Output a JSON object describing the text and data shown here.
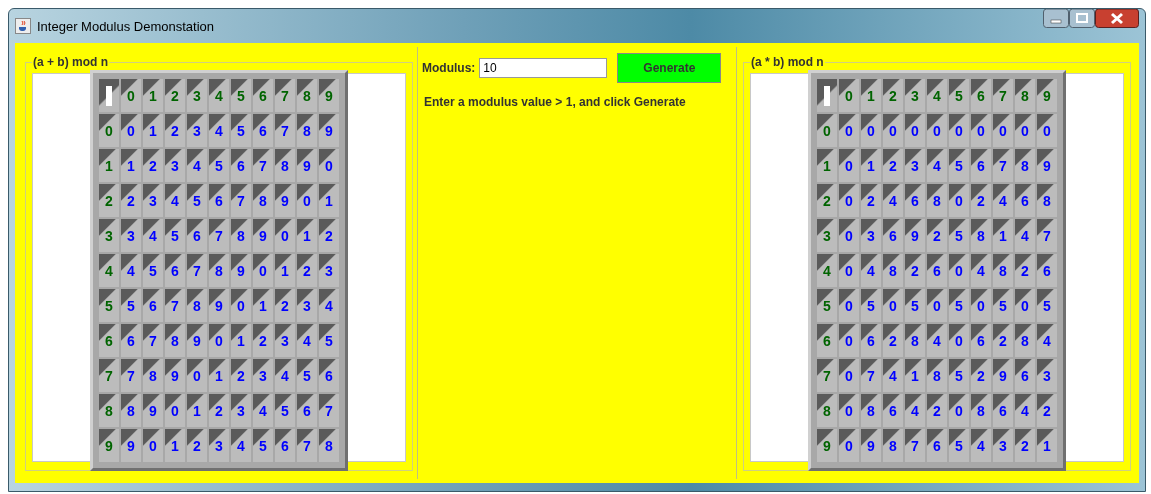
{
  "window": {
    "title": "Integer Modulus Demonstation"
  },
  "addition_panel": {
    "title": "(a + b) mod n",
    "column_headers": [
      "0",
      "1",
      "2",
      "3",
      "4",
      "5",
      "6",
      "7",
      "8",
      "9"
    ],
    "rows": [
      {
        "header": "0",
        "cells": [
          "0",
          "1",
          "2",
          "3",
          "4",
          "5",
          "6",
          "7",
          "8",
          "9"
        ]
      },
      {
        "header": "1",
        "cells": [
          "1",
          "2",
          "3",
          "4",
          "5",
          "6",
          "7",
          "8",
          "9",
          "0"
        ]
      },
      {
        "header": "2",
        "cells": [
          "2",
          "3",
          "4",
          "5",
          "6",
          "7",
          "8",
          "9",
          "0",
          "1"
        ]
      },
      {
        "header": "3",
        "cells": [
          "3",
          "4",
          "5",
          "6",
          "7",
          "8",
          "9",
          "0",
          "1",
          "2"
        ]
      },
      {
        "header": "4",
        "cells": [
          "4",
          "5",
          "6",
          "7",
          "8",
          "9",
          "0",
          "1",
          "2",
          "3"
        ]
      },
      {
        "header": "5",
        "cells": [
          "5",
          "6",
          "7",
          "8",
          "9",
          "0",
          "1",
          "2",
          "3",
          "4"
        ]
      },
      {
        "header": "6",
        "cells": [
          "6",
          "7",
          "8",
          "9",
          "0",
          "1",
          "2",
          "3",
          "4",
          "5"
        ]
      },
      {
        "header": "7",
        "cells": [
          "7",
          "8",
          "9",
          "0",
          "1",
          "2",
          "3",
          "4",
          "5",
          "6"
        ]
      },
      {
        "header": "8",
        "cells": [
          "8",
          "9",
          "0",
          "1",
          "2",
          "3",
          "4",
          "5",
          "6",
          "7"
        ]
      },
      {
        "header": "9",
        "cells": [
          "9",
          "0",
          "1",
          "2",
          "3",
          "4",
          "5",
          "6",
          "7",
          "8"
        ]
      }
    ]
  },
  "controls": {
    "modulus_label": "Modulus:",
    "modulus_value": "10",
    "generate_button": "Generate",
    "instruction": "Enter a modulus value > 1, and click Generate"
  },
  "multiplication_panel": {
    "title": "(a * b) mod n",
    "column_headers": [
      "0",
      "1",
      "2",
      "3",
      "4",
      "5",
      "6",
      "7",
      "8",
      "9"
    ],
    "rows": [
      {
        "header": "0",
        "cells": [
          "0",
          "0",
          "0",
          "0",
          "0",
          "0",
          "0",
          "0",
          "0",
          "0"
        ]
      },
      {
        "header": "1",
        "cells": [
          "0",
          "1",
          "2",
          "3",
          "4",
          "5",
          "6",
          "7",
          "8",
          "9"
        ]
      },
      {
        "header": "2",
        "cells": [
          "0",
          "2",
          "4",
          "6",
          "8",
          "0",
          "2",
          "4",
          "6",
          "8"
        ]
      },
      {
        "header": "3",
        "cells": [
          "0",
          "3",
          "6",
          "9",
          "2",
          "5",
          "8",
          "1",
          "4",
          "7"
        ]
      },
      {
        "header": "4",
        "cells": [
          "0",
          "4",
          "8",
          "2",
          "6",
          "0",
          "4",
          "8",
          "2",
          "6"
        ]
      },
      {
        "header": "5",
        "cells": [
          "0",
          "5",
          "0",
          "5",
          "0",
          "5",
          "0",
          "5",
          "0",
          "5"
        ]
      },
      {
        "header": "6",
        "cells": [
          "0",
          "6",
          "2",
          "8",
          "4",
          "0",
          "6",
          "2",
          "8",
          "4"
        ]
      },
      {
        "header": "7",
        "cells": [
          "0",
          "7",
          "4",
          "1",
          "8",
          "5",
          "2",
          "9",
          "6",
          "3"
        ]
      },
      {
        "header": "8",
        "cells": [
          "0",
          "8",
          "6",
          "4",
          "2",
          "0",
          "8",
          "6",
          "4",
          "2"
        ]
      },
      {
        "header": "9",
        "cells": [
          "0",
          "9",
          "8",
          "7",
          "6",
          "5",
          "4",
          "3",
          "2",
          "1"
        ]
      }
    ]
  }
}
